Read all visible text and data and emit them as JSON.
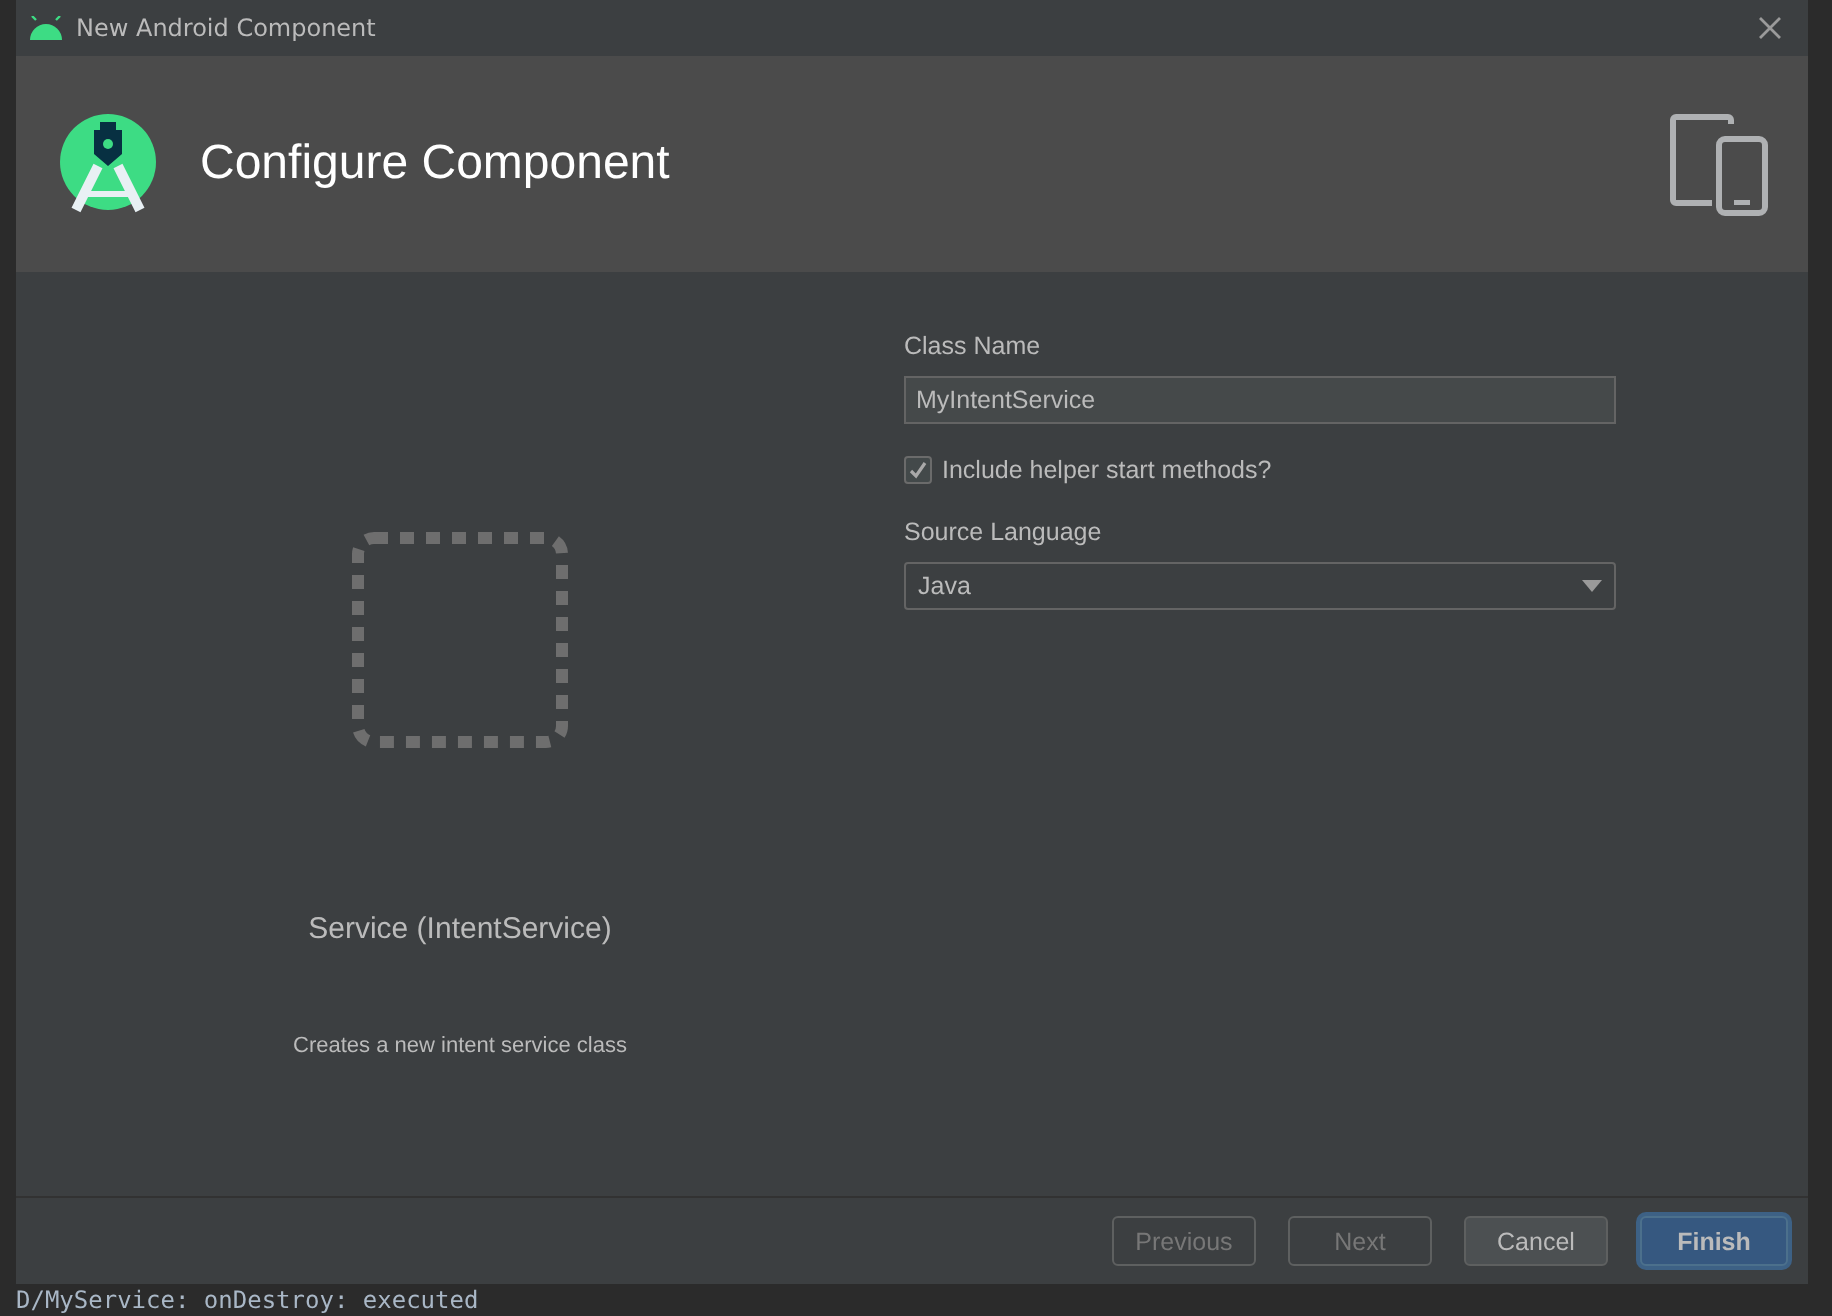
{
  "window": {
    "title": "New Android Component"
  },
  "header": {
    "title": "Configure Component"
  },
  "preview": {
    "name": "Service (IntentService)",
    "description": "Creates a new intent service class"
  },
  "form": {
    "class_name": {
      "label": "Class Name",
      "value": "MyIntentService"
    },
    "helper_methods": {
      "label": "Include helper start methods?",
      "checked": true
    },
    "source_language": {
      "label": "Source Language",
      "value": "Java"
    }
  },
  "buttons": [
    {
      "label": "Previous",
      "disabled": true,
      "default": false
    },
    {
      "label": "Next",
      "disabled": true,
      "default": false
    },
    {
      "label": "Cancel",
      "disabled": false,
      "default": false
    },
    {
      "label": "Finish",
      "disabled": false,
      "default": true
    }
  ],
  "background_log": {
    "line": "D/MyService: onDestroy: executed"
  }
}
